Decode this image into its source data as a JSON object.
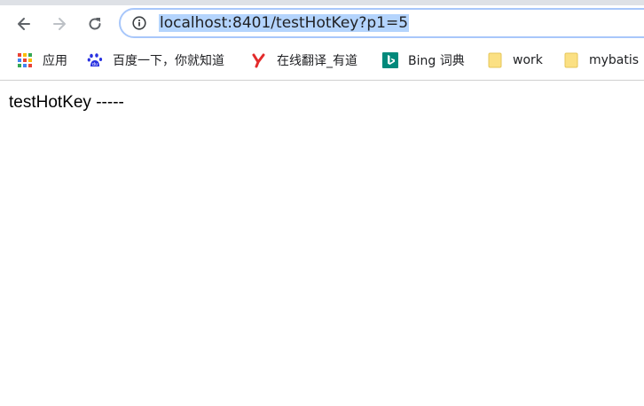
{
  "toolbar": {
    "back_icon": "arrow-left-icon",
    "forward_icon": "arrow-right-icon",
    "reload_icon": "reload-icon",
    "url": "localhost:8401/testHotKey?p1=5",
    "info_icon": "info-icon"
  },
  "bookmarks": {
    "items": [
      {
        "label": "应用",
        "icon": "apps-grid-icon"
      },
      {
        "label": "百度一下，你就知道",
        "icon": "baidu-paw-icon"
      },
      {
        "label": "在线翻译_有道",
        "icon": "youdao-icon"
      },
      {
        "label": "Bing 词典",
        "icon": "bing-icon"
      },
      {
        "label": "work",
        "icon": "folder-icon"
      },
      {
        "label": "mybatis",
        "icon": "folder-icon"
      }
    ]
  },
  "page": {
    "text": "testHotKey -----"
  },
  "colors": {
    "url_selection": "#b4d4fd",
    "omnibox_border": "#a8c7fa",
    "folder": "#fbe083",
    "bing": "#00897b",
    "youdao": "#e32b2b",
    "baidu": "#2932e1"
  }
}
